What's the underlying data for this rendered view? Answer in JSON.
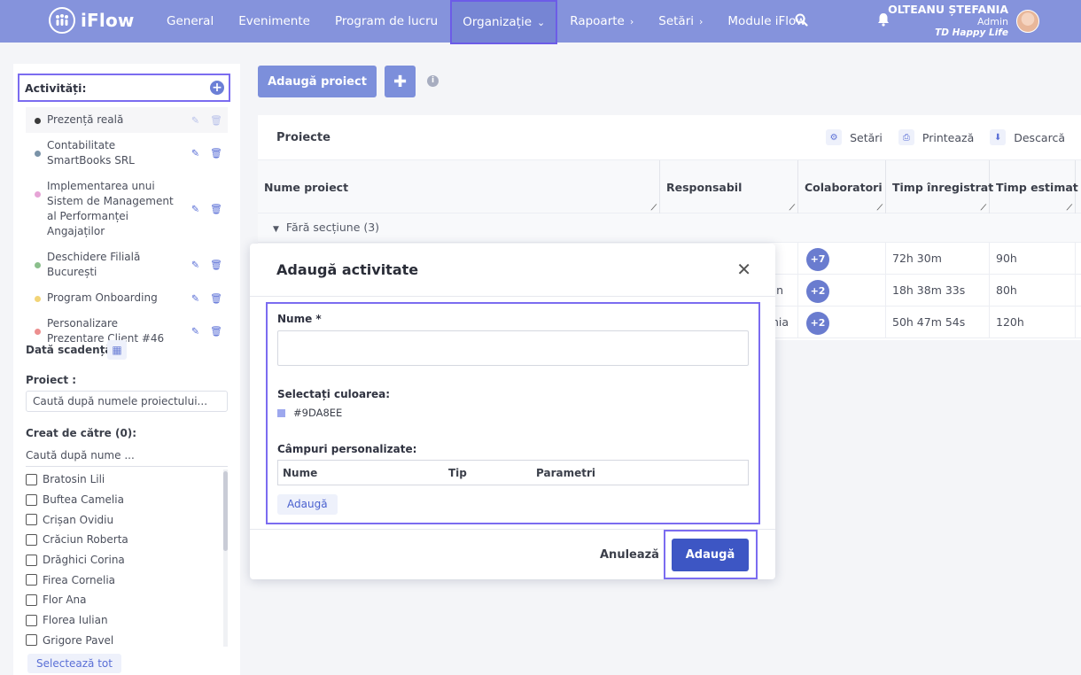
{
  "app": {
    "logo_text": "iFlow"
  },
  "nav": {
    "items": [
      {
        "label": "General",
        "chevron": ""
      },
      {
        "label": "Evenimente",
        "chevron": ""
      },
      {
        "label": "Program de lucru",
        "chevron": ""
      },
      {
        "label": "Organizație",
        "chevron": "⌄"
      },
      {
        "label": "Rapoarte",
        "chevron": "›"
      },
      {
        "label": "Setări",
        "chevron": "›"
      },
      {
        "label": "Module iFlow",
        "chevron": ""
      }
    ]
  },
  "user": {
    "name": "OLTEANU ȘTEFANIA",
    "role": "Admin",
    "company": "TD Happy Life"
  },
  "sidebar": {
    "activities_title": "Activități:",
    "activities": [
      {
        "label": "Prezență reală",
        "color": "#3a3a3a"
      },
      {
        "label": "Contabilitate SmartBooks SRL",
        "color": "#7a93a8"
      },
      {
        "label": "Implementarea unui Sistem de Management al Performanței Angajaților",
        "color": "#e6a4d6"
      },
      {
        "label": "Deschidere Filială București",
        "color": "#8bbf8c"
      },
      {
        "label": "Program Onboarding",
        "color": "#f2d477"
      },
      {
        "label": "Personalizare Prezentare Client #46",
        "color": "#ec8f8f"
      }
    ],
    "due_date_label": "Dată scadență:",
    "project_label": "Proiect :",
    "project_search_placeholder": "Caută după numele proiectului...",
    "created_by_label": "Creat de către (0):",
    "created_by_search_placeholder": "Caută după nume ...",
    "users": [
      "Bratosin Lili",
      "Buftea Camelia",
      "Crișan Ovidiu",
      "Crăciun Roberta",
      "Drăghici Corina",
      "Firea Cornelia",
      "Flor Ana",
      "Florea Iulian",
      "Grigore Pavel"
    ],
    "select_all": "Selectează tot"
  },
  "main": {
    "add_project_button": "Adaugă proiect",
    "panel_title": "Proiecte",
    "actions": {
      "settings": "Setări",
      "print": "Printează",
      "download": "Descarcă"
    },
    "columns": [
      "Nume proiect",
      "Responsabil",
      "Colaboratori",
      "Timp înregistrat",
      "Timp estimat"
    ],
    "section_label": "Fără secțiune (3)",
    "rows": [
      {
        "responsabil": "",
        "colab": "+7",
        "recorded": "72h 30m",
        "estimated": "90h"
      },
      {
        "responsabil": "n",
        "colab": "+2",
        "recorded": "18h 38m 33s",
        "estimated": "80h"
      },
      {
        "responsabil": "nia",
        "colab": "+2",
        "recorded": "50h 47m 54s",
        "estimated": "120h"
      }
    ]
  },
  "modal": {
    "title": "Adaugă activitate",
    "name_label": "Nume *",
    "name_value": "",
    "color_label": "Selectați culoarea:",
    "color_value": "#9DA8EE",
    "custom_fields_label": "Câmpuri personalizate:",
    "cf_columns": [
      "Nume",
      "Tip",
      "Parametri"
    ],
    "cf_add_button": "Adaugă",
    "cancel_button": "Anulează",
    "submit_button": "Adaugă"
  },
  "colors": {
    "nav_bg": "#8593dc",
    "accent": "#3d56c4",
    "highlight_outline": "#7b6cf0"
  }
}
